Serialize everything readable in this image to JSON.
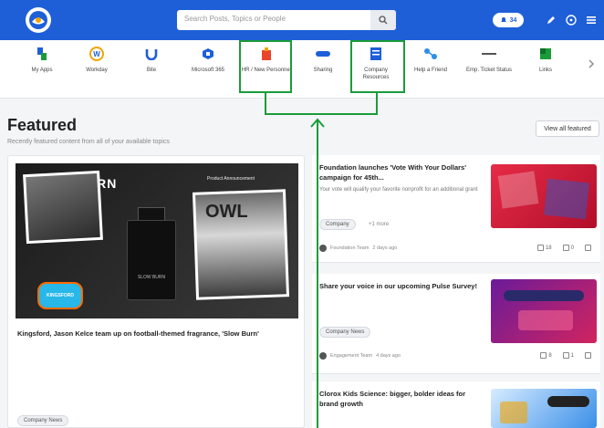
{
  "search": {
    "placeholder": "Search Posts, Topics or People"
  },
  "notifications": {
    "count": "34"
  },
  "apps": [
    {
      "label": "My Apps",
      "icon": "my-apps-icon",
      "color": "#1e5fd8"
    },
    {
      "label": "Workday",
      "icon": "workday-icon",
      "color": "#f4a300"
    },
    {
      "label": "Bite",
      "icon": "bite-icon",
      "color": "#1e5fd8"
    },
    {
      "label": "Microsoft 365",
      "icon": "microsoft-365-icon",
      "color": "#1e5fd8"
    },
    {
      "label": "HR / New Personnel",
      "icon": "hr-personnel-icon",
      "color": "#e8452c"
    },
    {
      "label": "Sharing",
      "icon": "sharing-icon",
      "color": "#1e5fd8"
    },
    {
      "label": "Company Resources",
      "icon": "company-resources-icon",
      "color": "#1e5fd8"
    },
    {
      "label": "Help a Friend",
      "icon": "help-friend-icon",
      "color": "#2b8fe8"
    },
    {
      "label": "Emp. Ticket Status",
      "icon": "ticket-status-icon",
      "color": "#555555"
    },
    {
      "label": "Links",
      "icon": "links-icon",
      "color": "#1a9c3a"
    }
  ],
  "featured": {
    "title": "Featured",
    "subtitle": "Recently featured content from all of your available topics",
    "view_all": "View all featured"
  },
  "main_post": {
    "title": "Kingsford, Jason Kelce team up on football-themed fragrance, 'Slow Burn'",
    "hero_brand": "SLOW BURN",
    "hero_overlay": "OWL",
    "hero_tag": "Product Announcement",
    "bottle_label": "SLOW BURN",
    "sticker": "KINGSFORD",
    "pill": "Company News"
  },
  "posts": [
    {
      "title": "Foundation launches 'Vote With Your Dollars' campaign for 45th...",
      "desc": "Your vote will qualify your favorite nonprofit for an additional grant",
      "pill": "Company",
      "more": "+1 more",
      "author": "Foundation Team",
      "time": "2 days ago",
      "likes": "18",
      "comments": "0",
      "thumb_color": "#d31f3b"
    },
    {
      "title": "Share your voice in our upcoming Pulse Survey!",
      "pill": "Company News",
      "author": "Engagement Team",
      "time": "4 days ago",
      "likes": "8",
      "comments": "1",
      "thumb_color": "#a01d52"
    },
    {
      "title": "Clorox Kids Science: bigger, bolder ideas for brand growth",
      "thumb_color": "#3b8fe8"
    }
  ]
}
